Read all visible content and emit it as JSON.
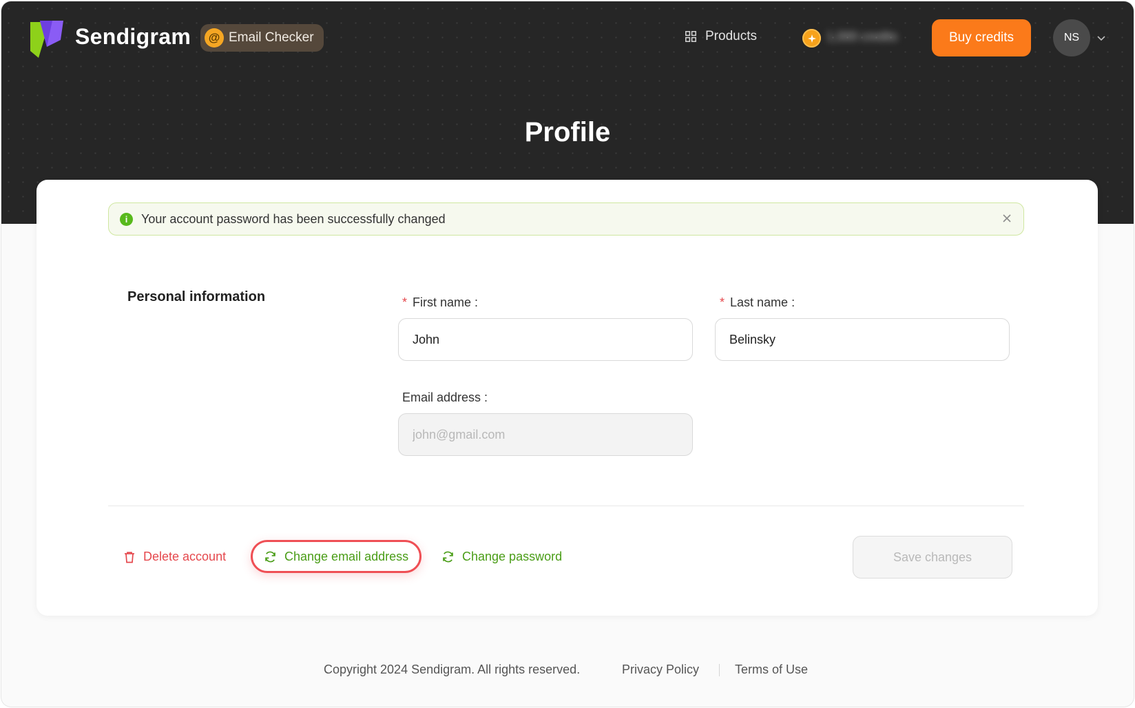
{
  "header": {
    "brand": "Sendigram",
    "app_chip": "Email Checker",
    "products_label": "Products",
    "credits_label": "1,000 credits",
    "buy_credits_label": "Buy credits",
    "avatar_initials": "NS"
  },
  "page": {
    "title": "Profile"
  },
  "alert": {
    "message": "Your account password has been successfully changed"
  },
  "personal_info": {
    "section_title": "Personal information",
    "first_name_label": "First name :",
    "first_name_value": "John",
    "last_name_label": "Last name :",
    "last_name_value": "Belinsky",
    "email_label": "Email address :",
    "email_placeholder": "john@gmail.com",
    "required_mark": "*"
  },
  "actions": {
    "delete_label": "Delete account",
    "change_email_label": "Change email address",
    "change_password_label": "Change password",
    "save_label": "Save changes"
  },
  "footer": {
    "copyright": "Copyright 2024 Sendigram. All rights reserved.",
    "privacy": "Privacy Policy",
    "terms": "Terms of Use"
  },
  "colors": {
    "accent_orange": "#fb7a1a",
    "success_green": "#4a9d17",
    "danger_red": "#e5484d",
    "hero_dark": "#262626"
  }
}
